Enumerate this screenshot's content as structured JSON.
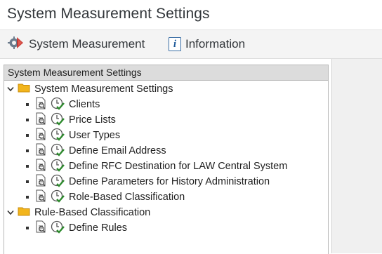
{
  "window": {
    "title": "System Measurement Settings"
  },
  "toolbar": {
    "system_measurement": {
      "label": "System Measurement",
      "icon": "system-measurement-icon"
    },
    "information": {
      "label": "Information",
      "icon": "info-icon"
    }
  },
  "tree": {
    "header": "System Measurement Settings",
    "groups": [
      {
        "label": "System Measurement Settings",
        "expanded": true,
        "items": [
          {
            "label": "Clients"
          },
          {
            "label": "Price Lists"
          },
          {
            "label": "User Types"
          },
          {
            "label": "Define Email Address"
          },
          {
            "label": "Define RFC Destination for LAW Central System"
          },
          {
            "label": "Define Parameters for History Administration"
          },
          {
            "label": "Role-Based Classification"
          }
        ]
      },
      {
        "label": "Rule-Based Classification",
        "expanded": true,
        "items": [
          {
            "label": "Define Rules"
          }
        ]
      }
    ]
  },
  "colors": {
    "folder": "#f2b51c",
    "check": "#2e8b2e",
    "info_border": "#3a6ea5",
    "header_bg": "#dcdcdc"
  }
}
